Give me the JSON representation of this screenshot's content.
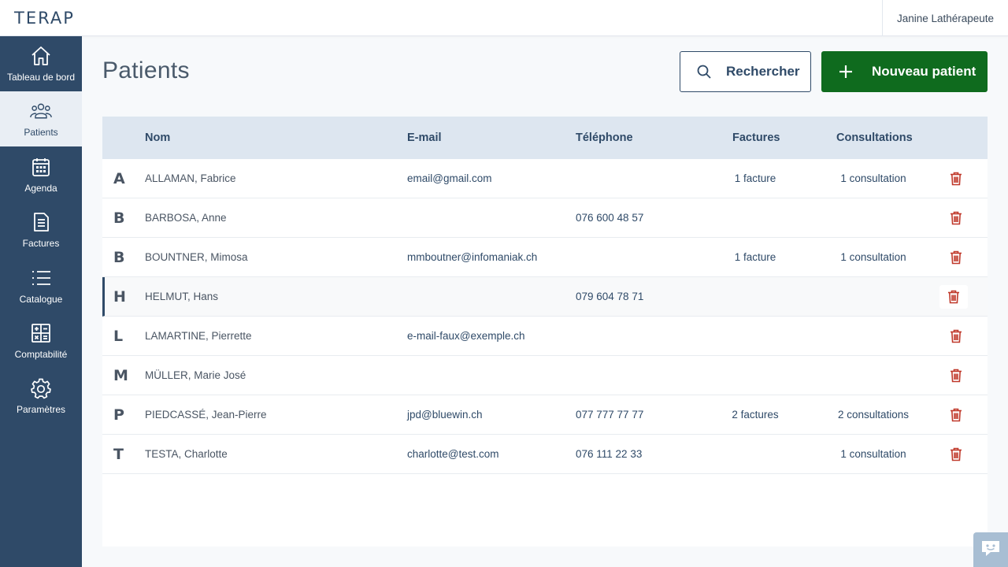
{
  "app": {
    "logo": "TERAP",
    "user": "Janine Lathérapeute"
  },
  "sidebar": {
    "items": [
      {
        "label": "Tableau de bord",
        "icon": "home-icon",
        "active": false
      },
      {
        "label": "Patients",
        "icon": "users-icon",
        "active": true
      },
      {
        "label": "Agenda",
        "icon": "calendar-icon",
        "active": false
      },
      {
        "label": "Factures",
        "icon": "invoice-icon",
        "active": false
      },
      {
        "label": "Catalogue",
        "icon": "list-icon",
        "active": false
      },
      {
        "label": "Comptabilité",
        "icon": "calculator-icon",
        "active": false
      },
      {
        "label": "Paramètres",
        "icon": "gear-icon",
        "active": false
      }
    ]
  },
  "page": {
    "title": "Patients",
    "search_label": "Rechercher",
    "new_label": "Nouveau patient"
  },
  "table": {
    "headers": {
      "nom": "Nom",
      "email": "E-mail",
      "telephone": "Téléphone",
      "factures": "Factures",
      "consultations": "Consultations"
    },
    "rows": [
      {
        "letter": "A",
        "name": "ALLAMAN, Fabrice",
        "email": "email@gmail.com",
        "phone": "",
        "factures": "1 facture",
        "consultations": "1 consultation"
      },
      {
        "letter": "B",
        "name": "BARBOSA, Anne",
        "email": "",
        "phone": "076 600 48 57",
        "factures": "",
        "consultations": ""
      },
      {
        "letter": "B",
        "name": "BOUNTNER, Mimosa",
        "email": "mmboutner@infomaniak.ch",
        "phone": "",
        "factures": "1 facture",
        "consultations": "1 consultation"
      },
      {
        "letter": "H",
        "name": "HELMUT, Hans",
        "email": "",
        "phone": "079 604 78 71",
        "factures": "",
        "consultations": ""
      },
      {
        "letter": "L",
        "name": "LAMARTINE, Pierrette",
        "email": "e-mail-faux@exemple.ch",
        "phone": "",
        "factures": "",
        "consultations": ""
      },
      {
        "letter": "M",
        "name": "MÜLLER, Marie José",
        "email": "",
        "phone": "",
        "factures": "",
        "consultations": ""
      },
      {
        "letter": "P",
        "name": "PIEDCASSÉ, Jean-Pierre",
        "email": "jpd@bluewin.ch",
        "phone": "077 777 77 77",
        "factures": "2 factures",
        "consultations": "2 consultations"
      },
      {
        "letter": "T",
        "name": "TESTA, Charlotte",
        "email": "charlotte@test.com",
        "phone": "076 111 22 33",
        "factures": "",
        "consultations": "1 consultation"
      }
    ]
  },
  "colors": {
    "sidebar": "#2f4a68",
    "primary_button": "#0f6b1e",
    "delete": "#c0392b",
    "header_row": "#dde6f0"
  }
}
